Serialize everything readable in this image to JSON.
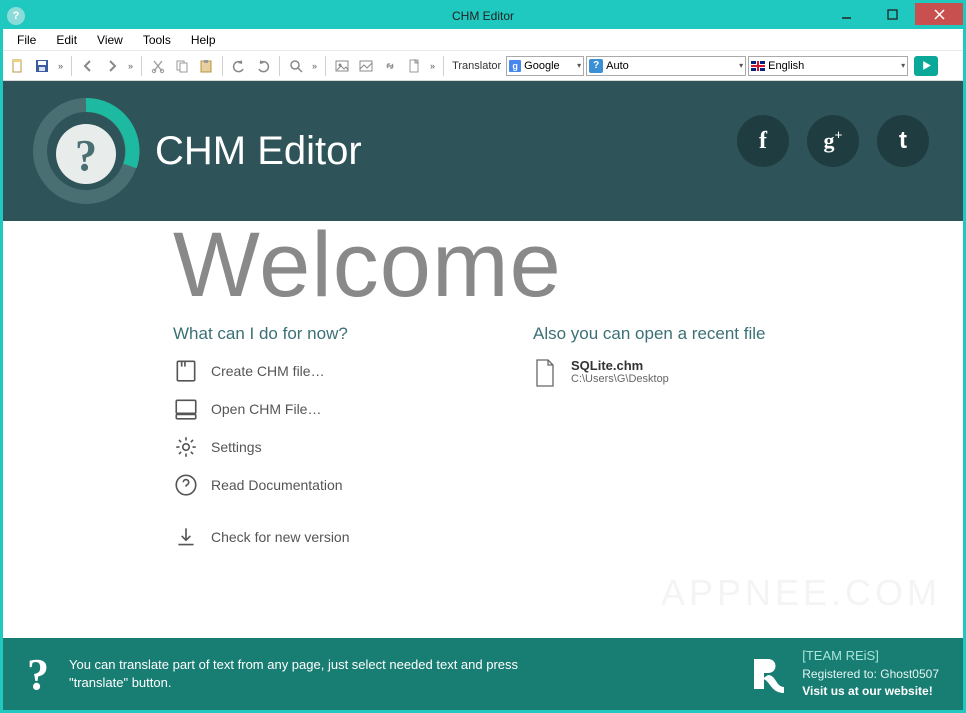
{
  "window": {
    "title": "CHM Editor"
  },
  "menubar": [
    "File",
    "Edit",
    "View",
    "Tools",
    "Help"
  ],
  "toolbar": {
    "translator_label": "Translator",
    "service": "Google",
    "source_lang": "Auto",
    "target_lang": "English"
  },
  "hero": {
    "app_name": "CHM Editor"
  },
  "welcome_heading": "Welcome",
  "left_col": {
    "heading": "What can I do for now?",
    "actions": {
      "create": "Create CHM file…",
      "open": "Open CHM File…",
      "settings": "Settings",
      "docs": "Read Documentation",
      "update": "Check for new version"
    }
  },
  "right_col": {
    "heading": "Also you can open a recent file",
    "recent": {
      "name": "SQLite.chm",
      "path": "C:\\Users\\G\\Desktop"
    }
  },
  "watermark": "APPNEE.COM",
  "footer": {
    "tip": "You can translate part of text from any page, just select needed text and press \"translate\" button.",
    "team": "[TEAM REiS]",
    "registered": "Registered to: Ghost0507",
    "link": "Visit us at our website!"
  }
}
